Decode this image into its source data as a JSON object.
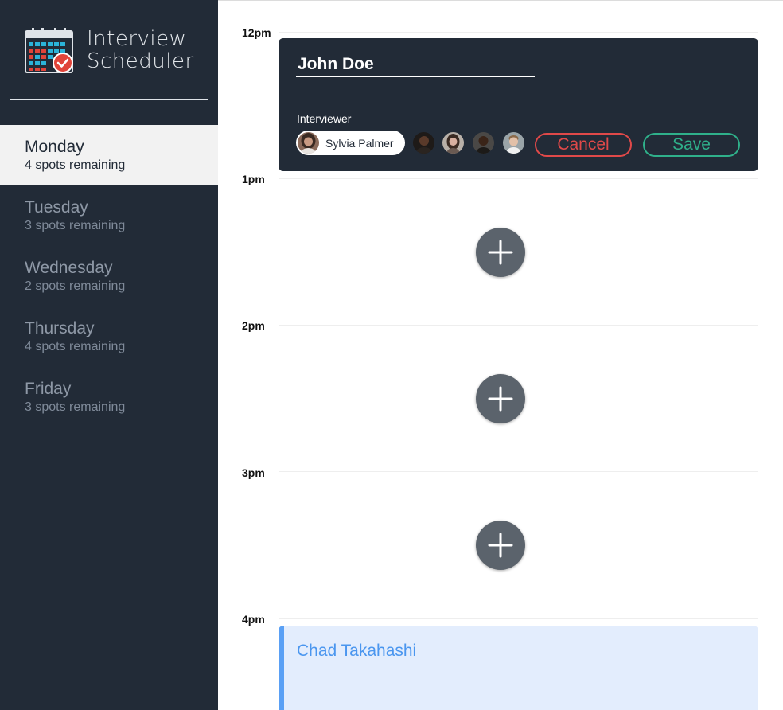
{
  "app": {
    "title_line1": "Interview",
    "title_line2": "Scheduler",
    "logo_icon": "calendar-check-icon"
  },
  "colors": {
    "sidebar_bg": "#222b37",
    "cancel": "#e04949",
    "save": "#2fb08a",
    "appointment_bg": "#e3edfd",
    "appointment_accent": "#5aa0f5"
  },
  "days": [
    {
      "name": "Monday",
      "spots": "4 spots remaining",
      "selected": true
    },
    {
      "name": "Tuesday",
      "spots": "3 spots remaining",
      "selected": false
    },
    {
      "name": "Wednesday",
      "spots": "2 spots remaining",
      "selected": false
    },
    {
      "name": "Thursday",
      "spots": "4 spots remaining",
      "selected": false
    },
    {
      "name": "Friday",
      "spots": "3 spots remaining",
      "selected": false
    }
  ],
  "schedule": {
    "hours": [
      "12pm",
      "1pm",
      "2pm",
      "3pm",
      "4pm"
    ],
    "add_icon": "plus-icon"
  },
  "form": {
    "student_name": "John Doe",
    "interviewer_label": "Interviewer",
    "selected_interviewer": "Sylvia Palmer",
    "interviewer_count": 5,
    "cancel_label": "Cancel",
    "save_label": "Save"
  },
  "appointment": {
    "student_name": "Chad Takahashi"
  }
}
